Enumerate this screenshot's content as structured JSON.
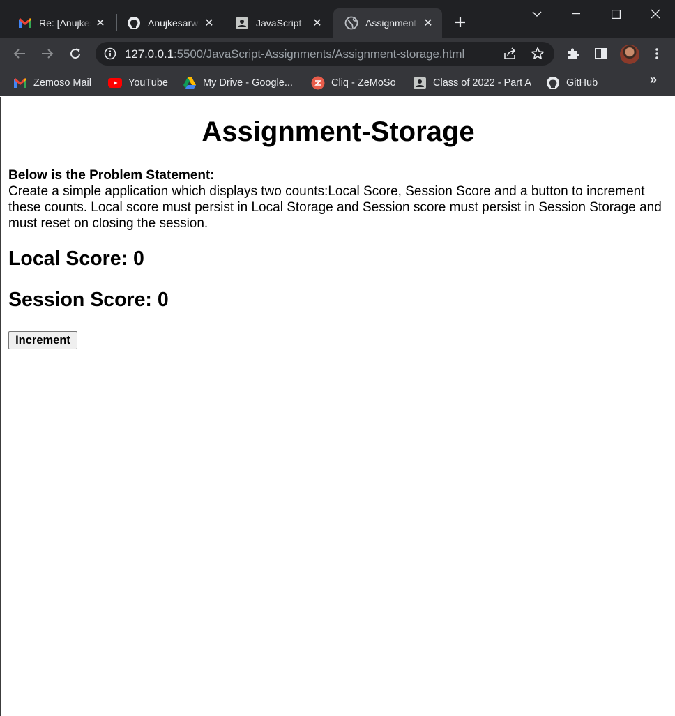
{
  "tabs": [
    {
      "label": "Re: [Anujkesarwani",
      "icon": "gmail-icon"
    },
    {
      "label": "Anujkesarwani",
      "icon": "github-icon"
    },
    {
      "label": "JavaScript",
      "icon": "classroom-icon"
    },
    {
      "label": "Assignment-Storage",
      "icon": "globe-icon",
      "active": true
    }
  ],
  "address_bar": {
    "host": "127.0.0.1",
    "path": ":5500/JavaScript-Assignments/Assignment-storage.html"
  },
  "bookmarks": [
    {
      "label": "Zemoso Mail",
      "icon": "gmail-icon"
    },
    {
      "label": "YouTube",
      "icon": "youtube-icon"
    },
    {
      "label": "My Drive - Google...",
      "icon": "google-drive-icon"
    },
    {
      "label": "Cliq - ZeMoSo",
      "icon": "cliq-icon"
    },
    {
      "label": "Class of 2022 - Part A",
      "icon": "classroom-icon"
    },
    {
      "label": "GitHub",
      "icon": "github-icon"
    }
  ],
  "bookmarks_more": "»",
  "page": {
    "title": "Assignment-Storage",
    "problem_label": "Below is the Problem Statement:",
    "problem_text": "Create a simple application which displays two counts:Local Score, Session Score and a button to increment these counts. Local score must persist in Local Storage and Session score must persist in Session Storage and must reset on closing the session.",
    "local_score": "Local Score: 0",
    "session_score": "Session Score: 0",
    "increment_label": "Increment"
  },
  "colors": {
    "chrome_dark": "#202124",
    "chrome_toolbar": "#35363a",
    "chrome_text": "#e8eaed",
    "url_path": "#9aa0a6"
  }
}
